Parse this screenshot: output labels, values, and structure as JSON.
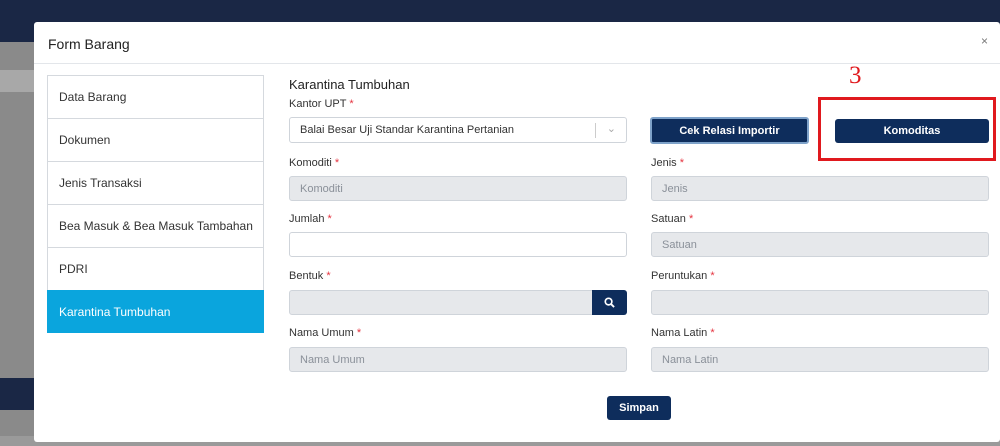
{
  "modal": {
    "title": "Form Barang",
    "close": "×"
  },
  "tabs": [
    {
      "label": "Data Barang",
      "active": false
    },
    {
      "label": "Dokumen",
      "active": false
    },
    {
      "label": "Jenis Transaksi",
      "active": false
    },
    {
      "label": "Bea Masuk & Bea Masuk Tambahan",
      "active": false
    },
    {
      "label": "PDRI",
      "active": false
    },
    {
      "label": "Karantina Tumbuhan",
      "active": true
    }
  ],
  "section_title": "Karantina Tumbuhan",
  "required_mark": "*",
  "form": {
    "kantor_upt": {
      "label": "Kantor UPT",
      "value": "Balai Besar Uji Standar Karantina Pertanian"
    },
    "komoditi": {
      "label": "Komoditi",
      "placeholder": "Komoditi"
    },
    "jenis": {
      "label": "Jenis",
      "placeholder": "Jenis"
    },
    "jumlah": {
      "label": "Jumlah",
      "value": ""
    },
    "satuan": {
      "label": "Satuan",
      "placeholder": "Satuan"
    },
    "bentuk": {
      "label": "Bentuk",
      "value": ""
    },
    "peruntukan": {
      "label": "Peruntukan",
      "value": ""
    },
    "nama_umum": {
      "label": "Nama Umum",
      "placeholder": "Nama Umum"
    },
    "nama_latin": {
      "label": "Nama Latin",
      "placeholder": "Nama Latin"
    }
  },
  "buttons": {
    "cek_relasi": "Cek Relasi Importir",
    "komoditas": "Komoditas",
    "simpan": "Simpan"
  },
  "annotation": {
    "step": "3"
  },
  "colors": {
    "primary": "#0e2d5c",
    "active_tab": "#0aa5dd",
    "highlight": "#e0191e"
  }
}
